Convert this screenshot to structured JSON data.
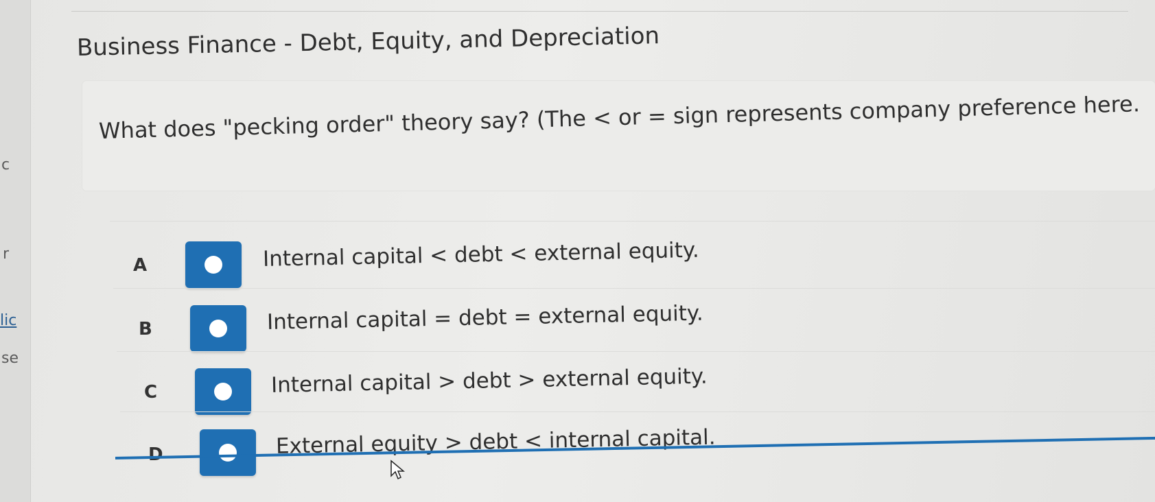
{
  "sidebar_fragments": [
    "c",
    "r",
    "lic",
    "se"
  ],
  "header": {
    "title": "Business Finance - Debt, Equity, and Depreciation"
  },
  "question": {
    "text": "What does \"pecking order\" theory say? (The < or = sign represents company preference here."
  },
  "options": [
    {
      "letter": "A",
      "text": "Internal capital < debt < external equity."
    },
    {
      "letter": "B",
      "text": "Internal capital = debt = external equity."
    },
    {
      "letter": "C",
      "text": "Internal capital > debt > external equity."
    },
    {
      "letter": "D",
      "text": "External equity > debt < internal capital."
    }
  ],
  "colors": {
    "accent": "#1f6fb3",
    "background": "#e9e9e7",
    "text": "#2e2e2e"
  },
  "icons": {
    "radio": "radio-circle-icon",
    "cursor": "mouse-pointer-icon"
  }
}
